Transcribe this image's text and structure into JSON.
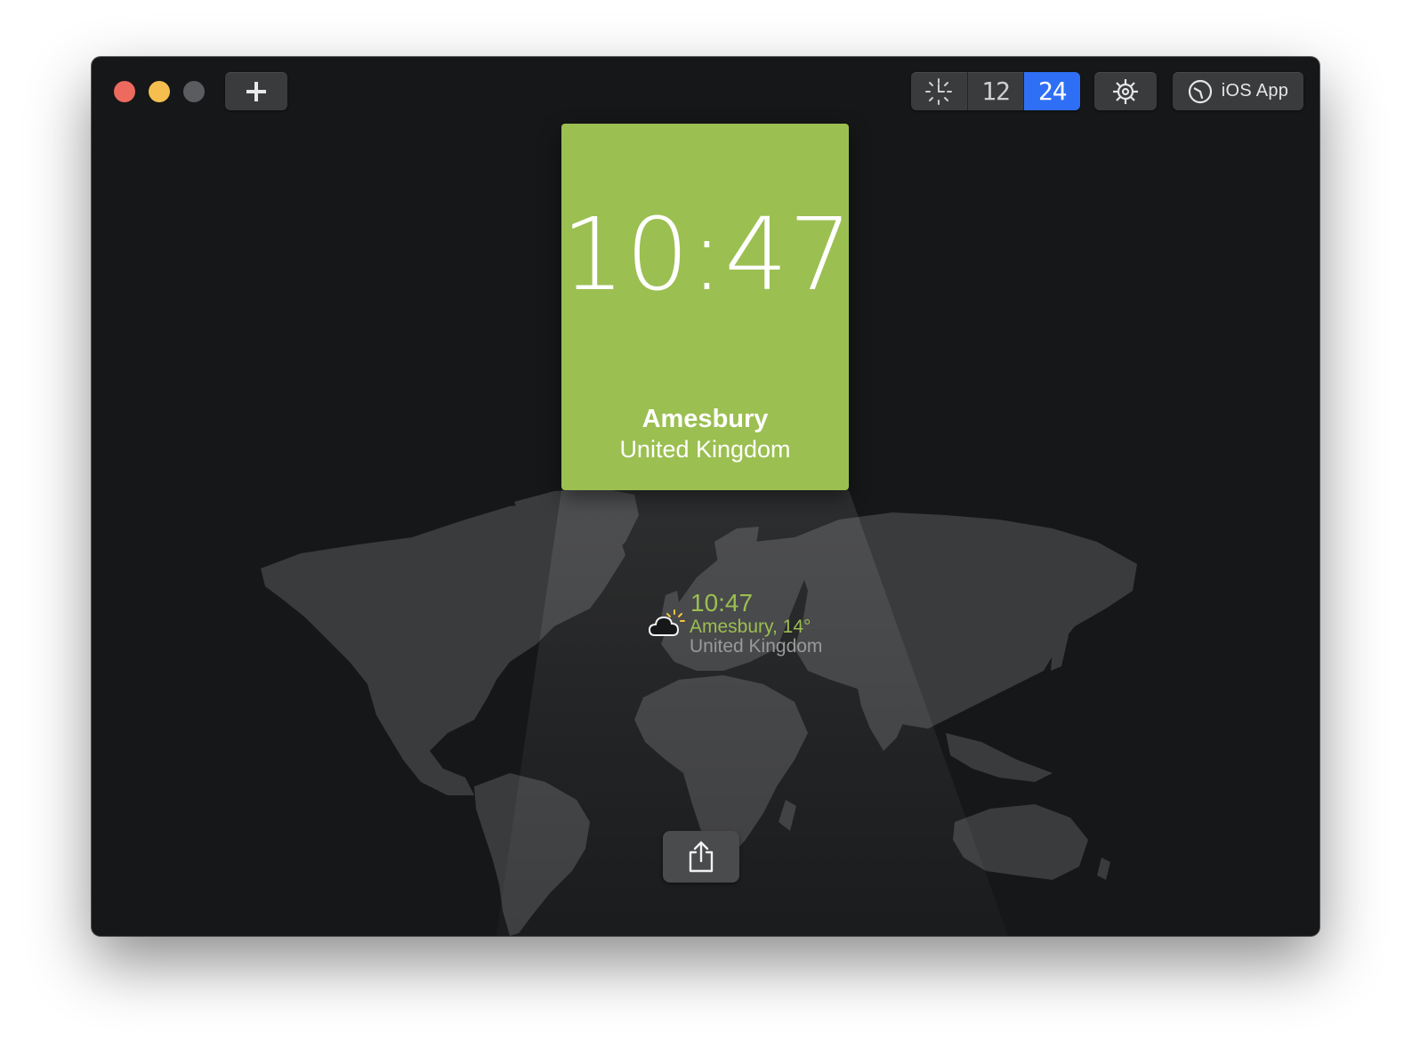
{
  "toolbar": {
    "add_icon": "plus-icon",
    "mode_segments": [
      {
        "name": "analog-clock-icon",
        "active": false
      },
      {
        "name": "12-hour-icon",
        "label": "12",
        "active": false
      },
      {
        "name": "24-hour-icon",
        "label": "24",
        "active": true
      }
    ],
    "settings_icon": "gear-icon",
    "ios_button_label": "iOS App"
  },
  "card": {
    "time": "10:47",
    "city": "Amesbury",
    "country": "United Kingdom",
    "color": "#9bbf51"
  },
  "marker": {
    "time": "10:47",
    "city_temp": "Amesbury, 14°",
    "country": "United Kingdom",
    "weather_icon": "partly-cloudy-icon"
  },
  "share": {
    "icon": "share-icon"
  },
  "colors": {
    "accent": "#9bbf51",
    "active_segment": "#2f6ff5",
    "window_bg": "#161718",
    "land": "#3b3c3e"
  }
}
